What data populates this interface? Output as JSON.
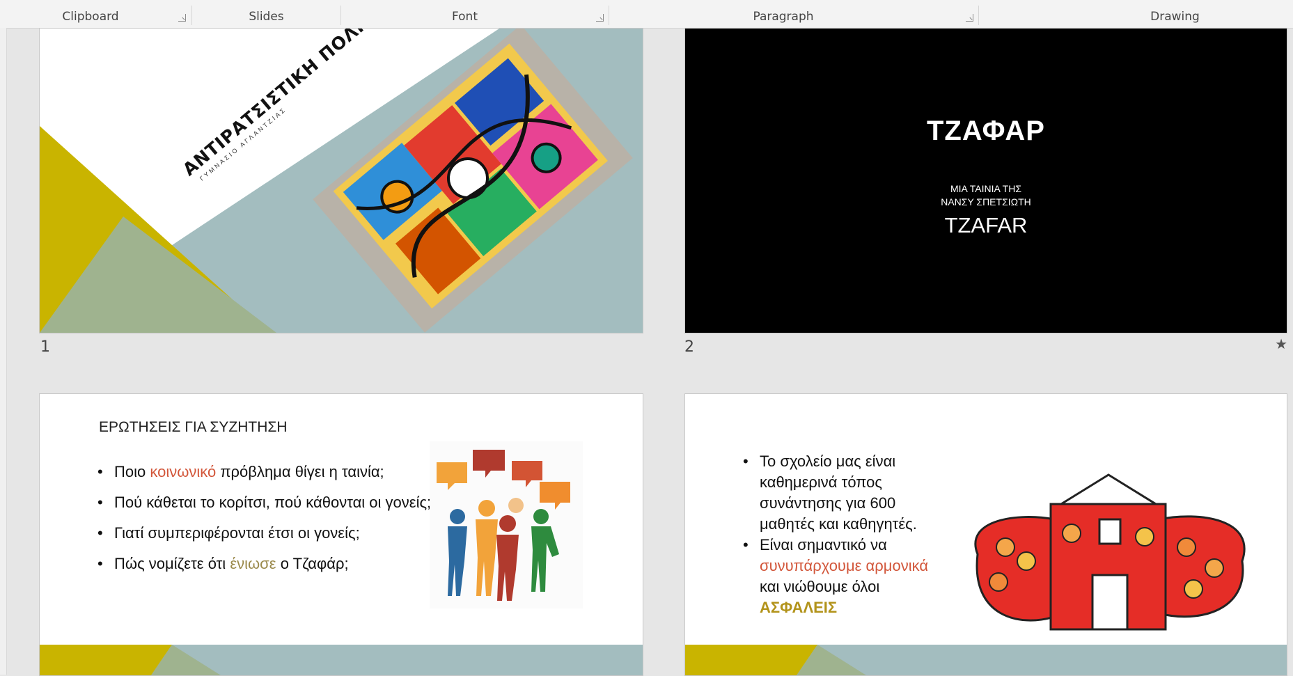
{
  "ribbon": {
    "groups": [
      "Clipboard",
      "Slides",
      "Font",
      "Paragraph",
      "Drawing"
    ]
  },
  "slides": [
    {
      "number": "1",
      "title": "ΑΝΤΙΡΑΤΣΙΣΤΙΚΗ ΠΟΛΙΤΙΚΗ",
      "subtitle": "ΓΥΜΝΑΣΙΟ ΑΓΛΑΝΤΖΙΑΣ"
    },
    {
      "number": "2",
      "title": "ΤΖΑΦΑΡ",
      "sub1": "ΜΙΑ ΤΑΙΝΙΑ ΤΗΣ",
      "sub2": "ΝΑΝΣΥ ΣΠΕΤΣΙΩΤΗ",
      "latin": "TZAFAR"
    },
    {
      "heading": "ΕΡΩΤΗΣΕΙΣ ΓΙΑ ΣΥΖΗΤΗΣΗ",
      "b1_pre": "Ποιο ",
      "b1_em": "κοινωνικό",
      "b1_post": " πρόβλημα θίγει η ταινία;",
      "b2": "Πού κάθεται το κορίτσι, πού κάθονται οι γονείς;",
      "b3": "Γιατί συμπεριφέρονται έτσι οι γονείς;",
      "b4_pre": "Πώς νομίζετε ότι ",
      "b4_em": "ένιωσε",
      "b4_post": " ο Τζαφάρ;"
    },
    {
      "b1": "Το σχολείο μας είναι καθημερινά τόπος συνάντησης για 600 μαθητές και καθηγητές.",
      "b2_pre": "Είναι σημαντικό να ",
      "b2_em": "συνυπάρχουμε αρμονικά",
      "b2_mid": " και νιώθουμε όλοι ",
      "b2_em2": "ΑΣΦΑΛΕΙΣ"
    }
  ],
  "colors": {
    "accent_gold": "#c9b400",
    "accent_sage": "#9fb38f",
    "slide_teal": "#a3bdbf",
    "emphasis_red": "#d2563a"
  },
  "icons": [
    "dialog-launcher-icon",
    "animation-star-icon"
  ]
}
